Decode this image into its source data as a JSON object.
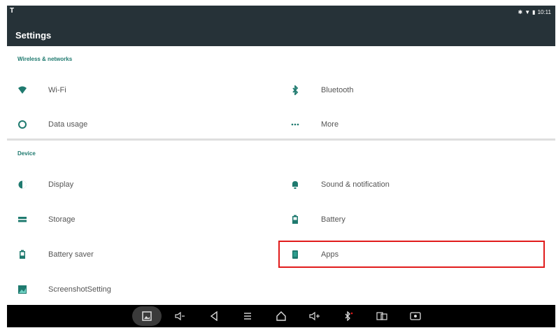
{
  "status_bar": {
    "time": "10:11",
    "left_indicator": "T"
  },
  "header": {
    "title": "Settings"
  },
  "sections": {
    "wireless": {
      "title": "Wireless & networks",
      "items": [
        {
          "label": "Wi-Fi",
          "icon": "wifi-icon"
        },
        {
          "label": "Bluetooth",
          "icon": "bluetooth-icon"
        },
        {
          "label": "Data usage",
          "icon": "data-usage-icon"
        },
        {
          "label": "More",
          "icon": "more-icon"
        }
      ]
    },
    "device": {
      "title": "Device",
      "items": [
        {
          "label": "Display",
          "icon": "display-icon"
        },
        {
          "label": "Sound & notification",
          "icon": "bell-icon"
        },
        {
          "label": "Storage",
          "icon": "storage-icon"
        },
        {
          "label": "Battery",
          "icon": "battery-icon"
        },
        {
          "label": "Battery saver",
          "icon": "battery-saver-icon"
        },
        {
          "label": "Apps",
          "icon": "apps-icon"
        },
        {
          "label": "ScreenshotSetting",
          "icon": "screenshot-icon"
        }
      ]
    }
  },
  "nav_bar": [
    "screenshot",
    "volume-down",
    "back",
    "menu",
    "home",
    "volume-up",
    "bluetooth",
    "recent",
    "record"
  ],
  "colors": {
    "appbar": "#263238",
    "accent": "#1f7a6f",
    "highlight": "#e11b1b"
  }
}
